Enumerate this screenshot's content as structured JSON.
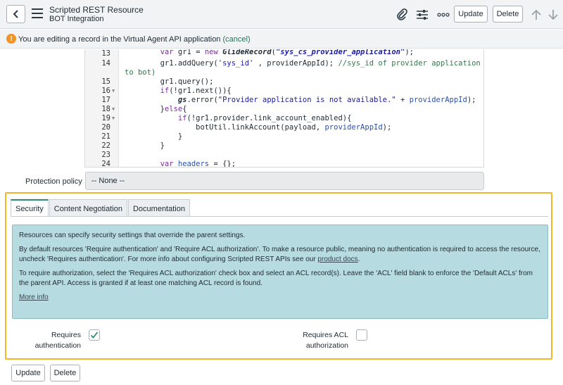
{
  "header": {
    "title": "Scripted REST Resource",
    "subtitle": "BOT Integration",
    "update_label": "Update",
    "delete_label": "Delete"
  },
  "alert": {
    "text": "You are editing a record in the Virtual Agent API application",
    "link": "(cancel)",
    "icon": "!"
  },
  "code": {
    "lines": [
      {
        "n": "13",
        "fold": ""
      },
      {
        "n": "14",
        "fold": ""
      },
      {
        "n": "15",
        "fold": ""
      },
      {
        "n": "16",
        "fold": "▼"
      },
      {
        "n": "17",
        "fold": ""
      },
      {
        "n": "18",
        "fold": "▼"
      },
      {
        "n": "19",
        "fold": "▼"
      },
      {
        "n": "20",
        "fold": ""
      },
      {
        "n": "21",
        "fold": ""
      },
      {
        "n": "22",
        "fold": ""
      },
      {
        "n": "23",
        "fold": ""
      },
      {
        "n": "24",
        "fold": ""
      }
    ],
    "wrap": "to bot)"
  },
  "protection_policy": {
    "label": "Protection policy",
    "value": "-- None --"
  },
  "tabs": [
    "Security",
    "Content Negotiation",
    "Documentation"
  ],
  "info": {
    "p1": "Resources can specify security settings that override the parent settings.",
    "p2a": "By default resources 'Require authentication' and 'Require ACL authorization'. To make a resource public, meaning no authentication is required to access the resource, uncheck 'Requires authentication'. For more info about configuring Scripted REST APIs see our ",
    "p2_link": "product docs",
    "p2b": ".",
    "p3": "To require authorization, select the 'Requires ACL authorization' check box and select an ACL record(s). Leave the 'ACL' field blank to enforce the 'Default ACLs' from the parent API. Access is granted if at least one matching ACL record is found.",
    "more": "More info"
  },
  "checkboxes": {
    "auth_line1": "Requires",
    "auth_line2": "authentication",
    "auth_checked": true,
    "acl_line1": "Requires ACL",
    "acl_line2": "authorization",
    "acl_checked": false
  },
  "footer": {
    "update_label": "Update",
    "delete_label": "Delete"
  },
  "colors": {
    "accent": "#2e8b6f",
    "highlight_border": "#f2b62a",
    "info_bg": "#b6dbe0",
    "warning": "#f0952a"
  }
}
